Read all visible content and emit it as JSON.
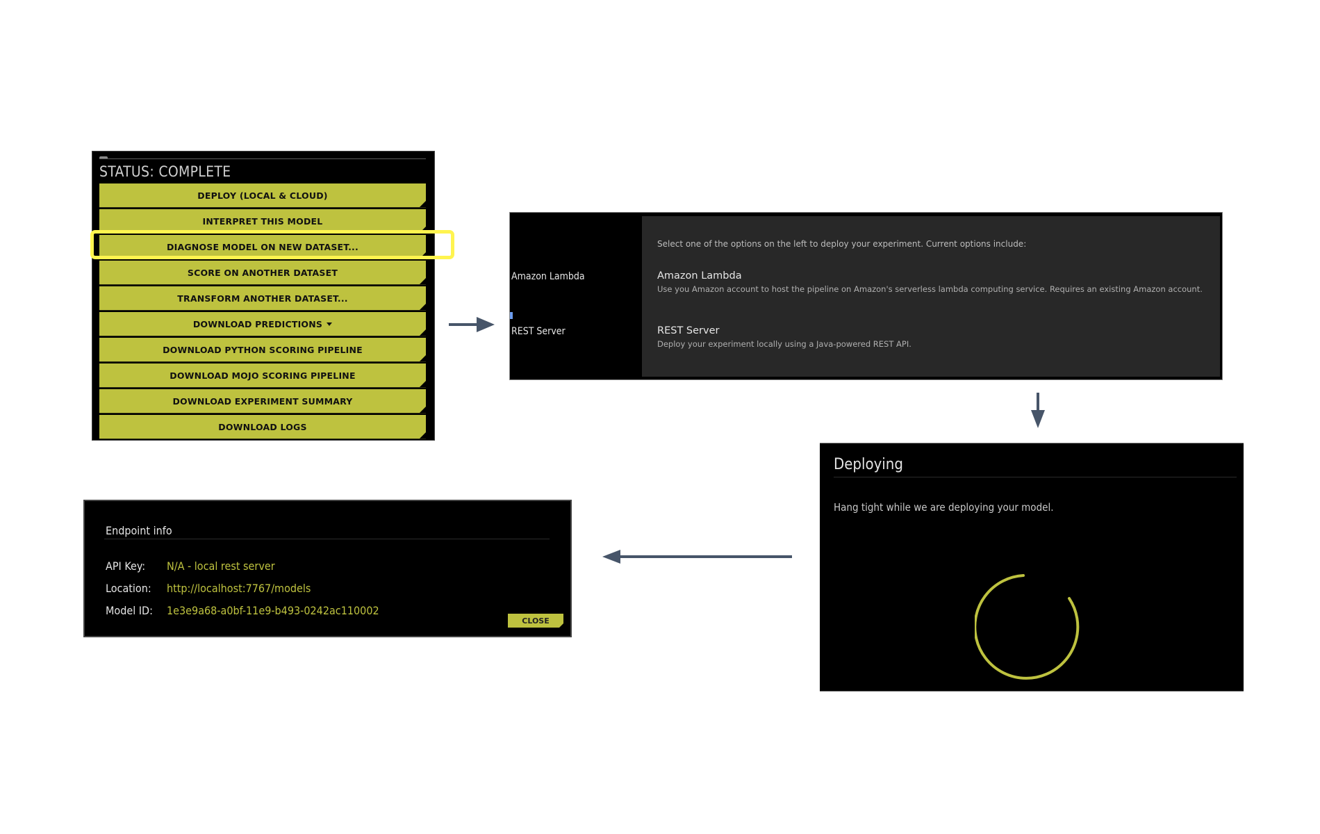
{
  "status_panel": {
    "title": "STATUS: COMPLETE",
    "highlighted_index": 2,
    "buttons": [
      {
        "label": "DEPLOY (LOCAL & CLOUD)"
      },
      {
        "label": "INTERPRET THIS MODEL"
      },
      {
        "label": "DIAGNOSE MODEL ON NEW DATASET..."
      },
      {
        "label": "SCORE ON ANOTHER DATASET"
      },
      {
        "label": "TRANSFORM ANOTHER DATASET..."
      },
      {
        "label": "DOWNLOAD PREDICTIONS",
        "icon": "caret-down-icon"
      },
      {
        "label": "DOWNLOAD PYTHON SCORING PIPELINE"
      },
      {
        "label": "DOWNLOAD MOJO SCORING PIPELINE"
      },
      {
        "label": "DOWNLOAD EXPERIMENT SUMMARY"
      },
      {
        "label": "DOWNLOAD LOGS"
      }
    ]
  },
  "deploy_panel": {
    "side_items": [
      {
        "label": "Amazon Lambda"
      },
      {
        "label": "REST Server"
      }
    ],
    "intro": "Select one of the options on the left to deploy your experiment. Current options include:",
    "options": [
      {
        "title": "Amazon Lambda",
        "description": "Use you Amazon account to host the pipeline on Amazon's serverless lambda computing service. Requires an existing Amazon account."
      },
      {
        "title": "REST Server",
        "description": "Deploy your experiment locally using a Java-powered REST API."
      }
    ]
  },
  "deploying_panel": {
    "title": "Deploying",
    "message": "Hang tight while we are deploying your model.",
    "spinner_icon": "loading-spinner-icon"
  },
  "endpoint_panel": {
    "title": "Endpoint info",
    "rows": [
      {
        "label": "API Key:",
        "value": "N/A - local rest server"
      },
      {
        "label": "Location:",
        "value": "http://localhost:7767/models"
      },
      {
        "label": "Model ID:",
        "value": "1e3e9a68-a0bf-11e9-b493-0242ac110002"
      }
    ],
    "close_label": "CLOSE"
  },
  "colors": {
    "accent": "#bec23f",
    "highlight": "#fff44f",
    "arrow": "#475569",
    "panel_bg": "#000000",
    "content_bg": "#282828"
  }
}
